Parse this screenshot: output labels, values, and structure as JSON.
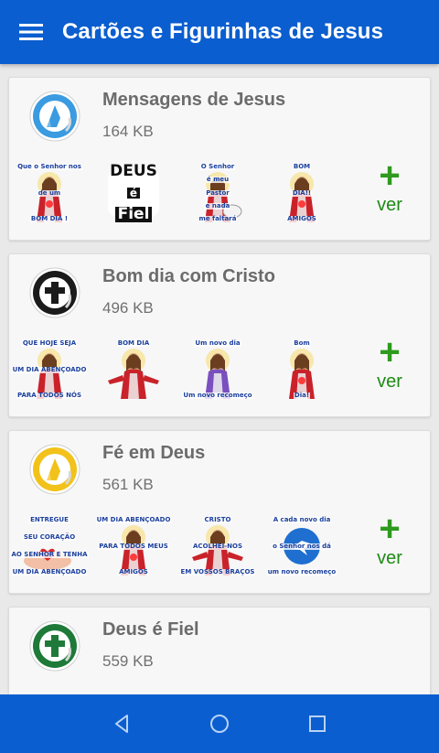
{
  "app": {
    "title": "Cartões e Figurinhas de Jesus"
  },
  "packs": [
    {
      "name": "Mensagens de Jesus",
      "size": "164 KB",
      "icon": "praying-hands-icon",
      "icon_color": "#3a9be0",
      "more_label": "ver",
      "more_symbol": "+",
      "stickers": [
        {
          "lines": [
            "Que o Senhor nos",
            "de um",
            "BOM DIA !"
          ],
          "type": "jesus-sacred-heart"
        },
        {
          "lines": [
            "DEUS",
            "é",
            "Fiel"
          ],
          "type": "text-logo"
        },
        {
          "lines": [
            "O Senhor",
            "é meu",
            "Pastor",
            "e nada",
            "me faltará"
          ],
          "type": "shepherd"
        },
        {
          "lines": [
            "BOM",
            "DIA!!",
            "AMIGOS"
          ],
          "type": "jesus-sacred-heart"
        }
      ]
    },
    {
      "name": "Bom dia com Cristo",
      "size": "496 KB",
      "icon": "cross-icon",
      "icon_color": "#1b1b1b",
      "more_label": "ver",
      "more_symbol": "+",
      "stickers": [
        {
          "lines": [
            "QUE HOJE SEJA",
            "UM DIA ABENÇOADO",
            "PARA TODOS NÓS"
          ],
          "type": "jesus-portrait"
        },
        {
          "lines": [
            "BOM DIA"
          ],
          "type": "jesus-open-arms"
        },
        {
          "lines": [
            "Um novo dia",
            "Um novo recomeço"
          ],
          "type": "jesus-colorful"
        },
        {
          "lines": [
            "Bom",
            "Dia!"
          ],
          "type": "jesus-sacred-heart"
        }
      ]
    },
    {
      "name": "Fé em Deus",
      "size": "561 KB",
      "icon": "praying-hands-icon",
      "icon_color": "#f2c21a",
      "more_label": "ver",
      "more_symbol": "+",
      "stickers": [
        {
          "lines": [
            "ENTREGUE",
            "SEU CORAÇÃO",
            "AO SENHOR E TENHA",
            "UM DIA ABENÇOADO"
          ],
          "type": "hands-heart"
        },
        {
          "lines": [
            "UM DIA ABENÇOADO",
            "PARA TODOS MEUS",
            "AMIGOS"
          ],
          "type": "jesus-sacred-heart"
        },
        {
          "lines": [
            "CRISTO",
            "ACOLHEI-NOS",
            "EM VOSSOS BRAÇOS"
          ],
          "type": "jesus-open-arms"
        },
        {
          "lines": [
            "A cada novo dia",
            "o Senhor nos dá",
            "um novo recomeço"
          ],
          "type": "dove"
        }
      ]
    },
    {
      "name": "Deus é Fiel",
      "size": "559 KB",
      "icon": "cross-icon",
      "icon_color": "#1f7a3a",
      "more_label": "ver",
      "more_symbol": "+",
      "stickers": []
    }
  ],
  "navbar": {
    "back": "back-icon",
    "home": "home-icon",
    "recents": "recents-icon"
  },
  "colors": {
    "appbar": "#0a5ecf",
    "accent_green": "#2e9a1e",
    "card_bg": "#f7f7f7",
    "page_bg": "#e9e9e9"
  }
}
